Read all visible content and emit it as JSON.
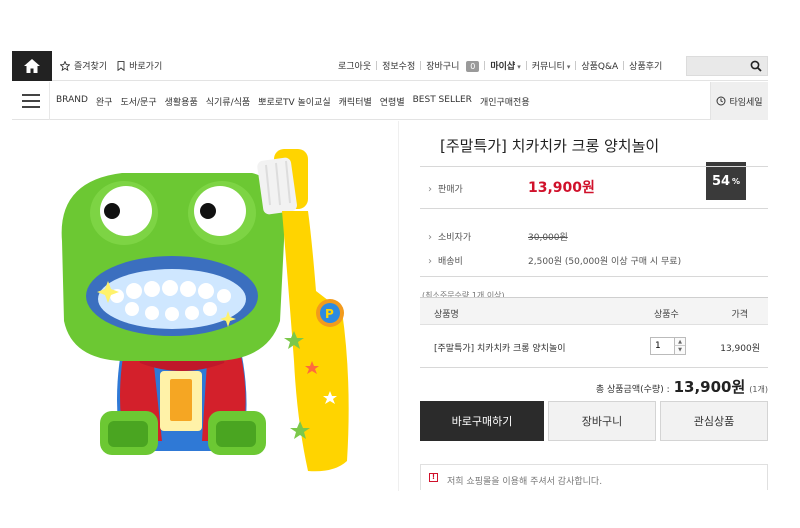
{
  "header": {
    "home_icon": "home-icon",
    "bookmark_label": "즐겨찾기",
    "shortcut_label": "바로가기",
    "links": [
      {
        "label": "로그아웃"
      },
      {
        "label": "정보수정"
      },
      {
        "label": "장바구니",
        "count": "0"
      },
      {
        "label": "마이샵"
      },
      {
        "label": "커뮤니티"
      },
      {
        "label": "상품Q&A"
      },
      {
        "label": "상품후기"
      }
    ],
    "search_placeholder": ""
  },
  "nav": {
    "categories": [
      "BRAND",
      "완구",
      "도서/문구",
      "생활용품",
      "식기류/식품",
      "뽀로로TV 놀이교실",
      "캐릭터별",
      "연령별",
      "BEST SELLER",
      "개인구매전용"
    ],
    "timesale_label": "타임세일"
  },
  "product": {
    "title": "[주말특가] 치카치카 크롱 양치놀이",
    "discount_value": "54",
    "discount_unit": "%",
    "price_label": "판매가",
    "price": "13,900원",
    "msrp_label": "소비자가",
    "msrp": "30,000원",
    "shipping_label": "배송비",
    "shipping": "2,500원 (50,000원 이상 구매 시 무료)",
    "min_order": "(최소주문수량 1개 이상)"
  },
  "options": {
    "headers": {
      "name": "상품명",
      "qty": "상품수",
      "price": "가격"
    },
    "rows": [
      {
        "name": "[주말특가] 치카치카 크롱 양치놀이",
        "qty": "1",
        "price": "13,900원"
      }
    ]
  },
  "total": {
    "label": "총 상품금액(수량) :",
    "amount": "13,900원",
    "count": "(1개)"
  },
  "buttons": {
    "buy": "바로구매하기",
    "cart": "장바구니",
    "wish": "관심상품"
  },
  "notice": {
    "text": "저희 쇼핑몰을 이용해 주셔서 감사합니다."
  },
  "colors": {
    "accent_red": "#d0112b",
    "dark": "#2b2b2b"
  }
}
